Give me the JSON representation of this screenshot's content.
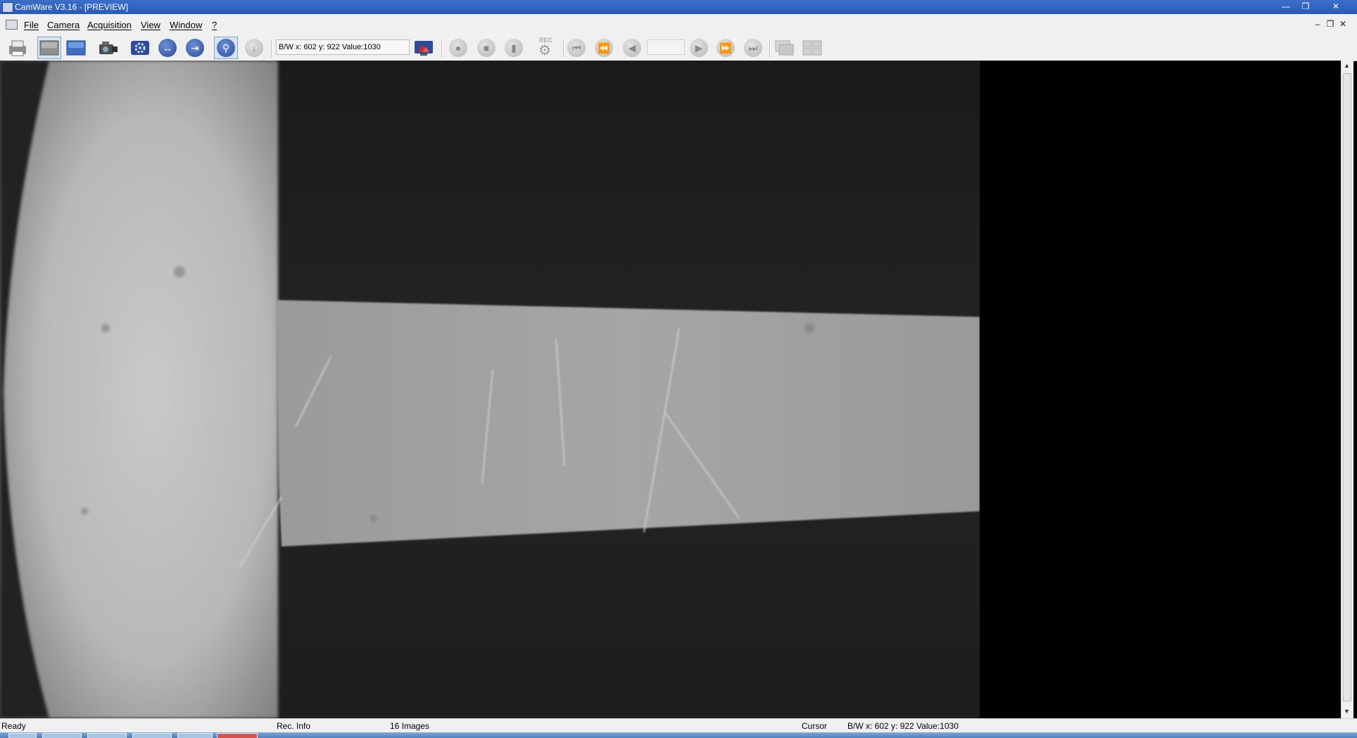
{
  "window": {
    "title": "CamWare V3.16 - [PREVIEW]",
    "controls": [
      "minimize-icon",
      "restore-icon",
      "close-icon"
    ]
  },
  "menu": {
    "items": [
      "File",
      "Camera",
      "Acquisition",
      "View",
      "Window",
      "?"
    ]
  },
  "toolbar": {
    "cursor_info": "B/W x: 602 y: 922 Value:1030",
    "rec_label": "REC",
    "frame_number": ""
  },
  "status": {
    "state": "Ready",
    "rec_info": "Rec. Info",
    "images": "16 Images",
    "cursor_label": "Cursor",
    "cursor_value": "B/W x: 602 y: 922 Value:1030"
  },
  "colors": {
    "titlebar": "#2a5bb7",
    "chrome": "#f0f0f0",
    "canvas": "#000000",
    "image_light": "#bdbdbd",
    "image_dark": "#1f1f1f"
  }
}
